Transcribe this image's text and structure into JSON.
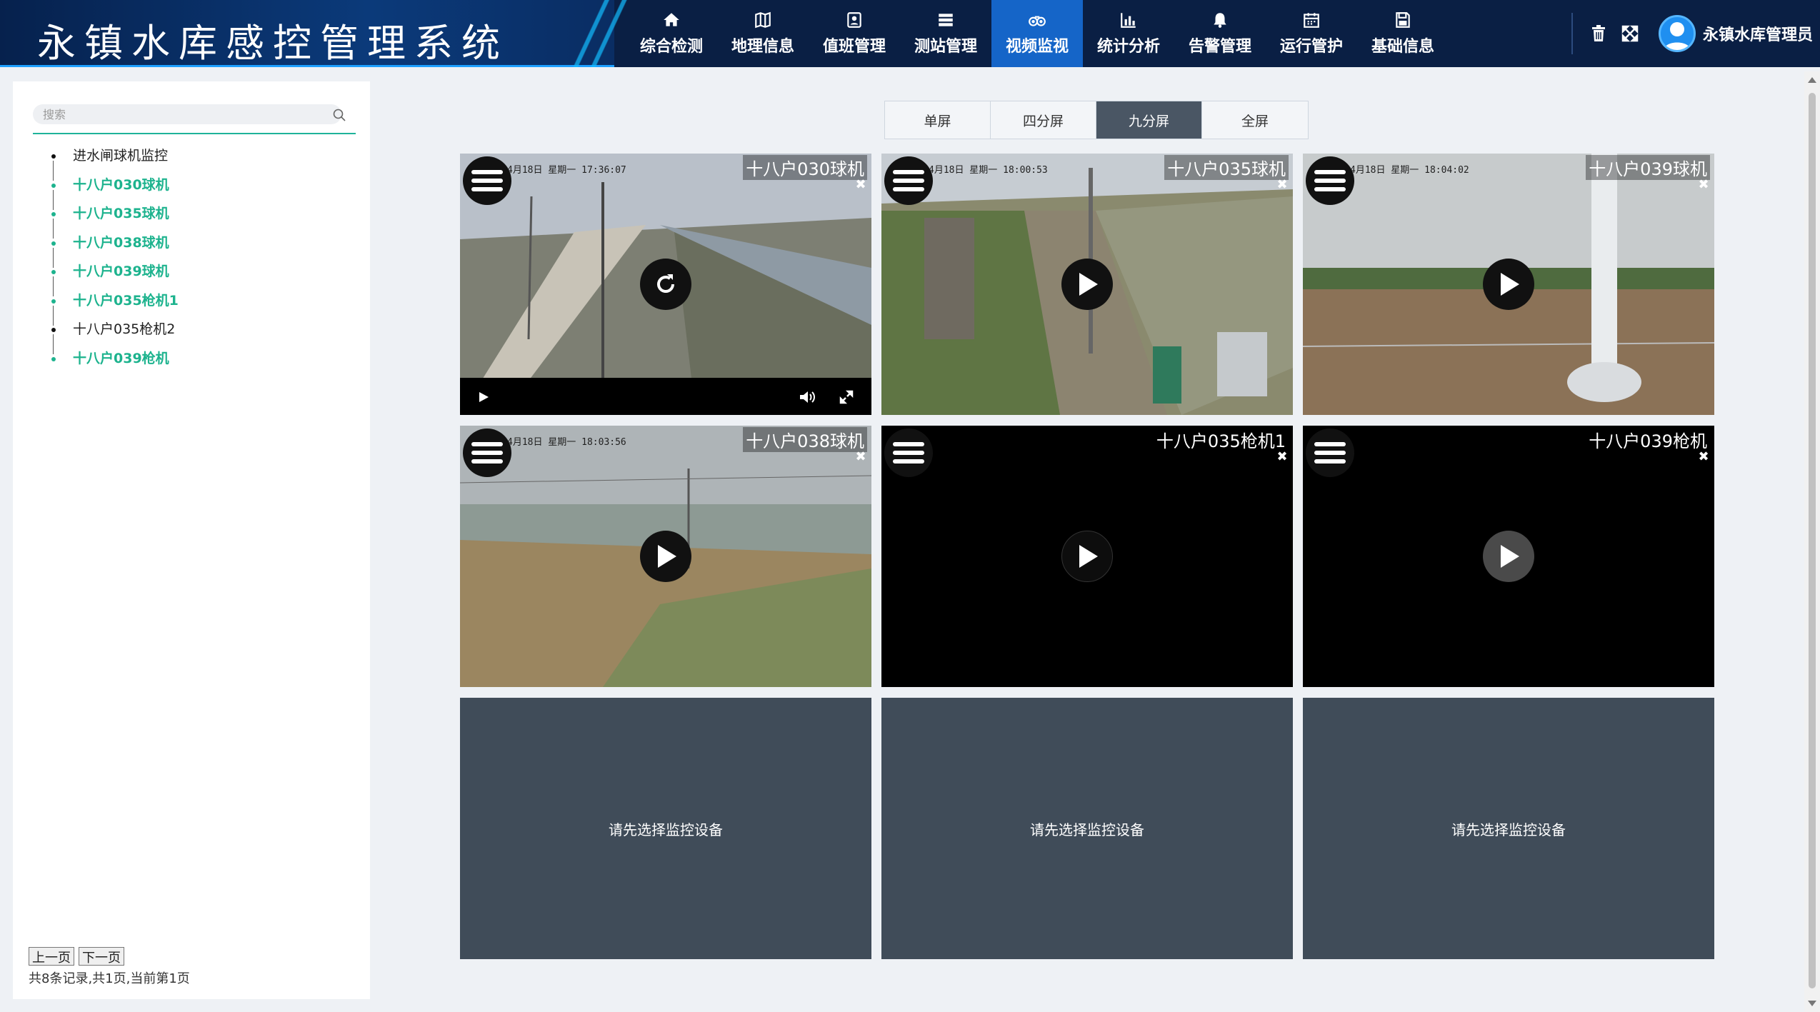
{
  "app": {
    "title": "永镇水库感控管理系统"
  },
  "nav": [
    {
      "label": "综合检测",
      "icon": "home-icon"
    },
    {
      "label": "地理信息",
      "icon": "map-icon"
    },
    {
      "label": "值班管理",
      "icon": "duty-icon"
    },
    {
      "label": "测站管理",
      "icon": "server-icon"
    },
    {
      "label": "视频监视",
      "icon": "binoculars-icon",
      "active": true
    },
    {
      "label": "统计分析",
      "icon": "bar-chart-icon"
    },
    {
      "label": "告警管理",
      "icon": "bell-icon"
    },
    {
      "label": "运行管护",
      "icon": "calendar-icon"
    },
    {
      "label": "基础信息",
      "icon": "save-icon"
    }
  ],
  "header": {
    "username": "永镇水库管理员"
  },
  "sidebar": {
    "search_placeholder": "搜索",
    "tree": [
      {
        "label": "进水闸球机监控",
        "style": "lvl1"
      },
      {
        "label": "十八户030球机",
        "style": "green"
      },
      {
        "label": "十八户035球机",
        "style": "green"
      },
      {
        "label": "十八户038球机",
        "style": "green"
      },
      {
        "label": "十八户039球机",
        "style": "green"
      },
      {
        "label": "十八户035枪机1",
        "style": "green"
      },
      {
        "label": "十八户035枪机2",
        "style": "black"
      },
      {
        "label": "十八户039枪机",
        "style": "green"
      }
    ],
    "prev_label": "上一页",
    "next_label": "下一页",
    "pager_info": "共8条记录,共1页,当前第1页"
  },
  "layout_tabs": [
    {
      "label": "单屏"
    },
    {
      "label": "四分屏"
    },
    {
      "label": "九分屏",
      "active": true
    },
    {
      "label": "全屏"
    }
  ],
  "cells": [
    {
      "camera": "十八户030球机",
      "osd": "4月18日 星期一 17:36:07",
      "state": "refresh"
    },
    {
      "camera": "十八户035球机",
      "osd": "4月18日 星期一 18:00:53",
      "state": "play"
    },
    {
      "camera": "十八户039球机",
      "osd": "4月18日 星期一 18:04:02",
      "state": "play"
    },
    {
      "camera": "十八户038球机",
      "osd": "4月18日 星期一 18:03:56",
      "state": "play"
    },
    {
      "camera": "十八户035枪机1",
      "state": "play"
    },
    {
      "camera": "十八户039枪机",
      "state": "play"
    }
  ],
  "empty_text": "请先选择监控设备"
}
